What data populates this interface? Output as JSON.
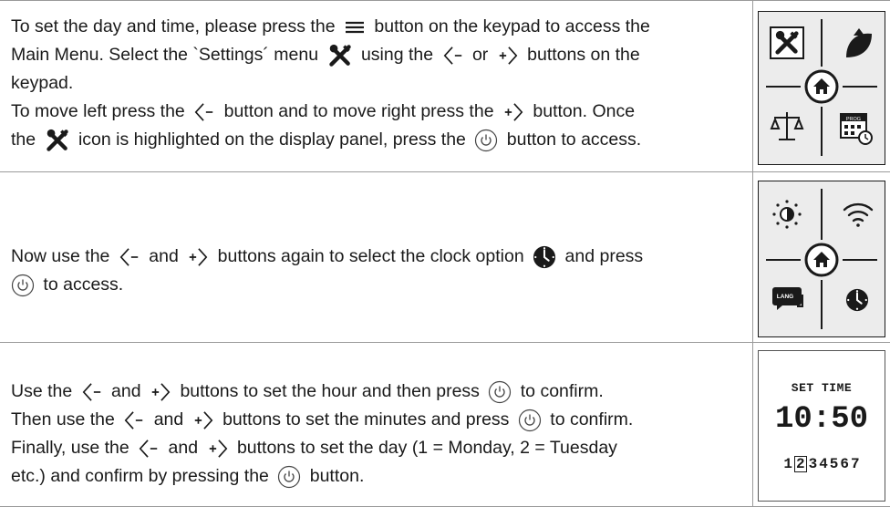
{
  "rows": [
    {
      "line1": {
        "a": "To set the day and time, please press the",
        "b": "button on the keypad to access the"
      },
      "line2": {
        "a": "Main Menu. Select the `Settings´ menu",
        "b": "using the",
        "c": "or",
        "d": "buttons on the"
      },
      "line3": {
        "a": "keypad."
      },
      "line4": {
        "a": "To move left press the",
        "b": "button and to move right press the",
        "c": "button. Once"
      },
      "line5": {
        "a": "the",
        "b": "icon is highlighted on the display panel, press the",
        "c": "button to access."
      }
    },
    {
      "line1": {
        "a": "Now use the",
        "b": "and",
        "c": "buttons again to select the clock option",
        "d": "and press"
      },
      "line2": {
        "a": "to access."
      },
      "lang_label": "LANG"
    },
    {
      "line1": {
        "a": "Use the",
        "b": "and",
        "c": "buttons to set the hour and then press",
        "d": "to confirm."
      },
      "line2": {
        "a": "Then use the",
        "b": "and",
        "c": "buttons to set the minutes and press",
        "d": "to confirm."
      },
      "line3": {
        "a": "Finally, use the",
        "b": "and",
        "c": "buttons to set the day (1 = Monday, 2 = Tuesday"
      },
      "line4": {
        "a": "etc.) and confirm by pressing the",
        "b": "button."
      }
    }
  ],
  "display": {
    "title": "SET TIME",
    "time": "10:50",
    "days": [
      "1",
      "2",
      "3",
      "4",
      "5",
      "6",
      "7"
    ],
    "selected_day": "2"
  },
  "panel1": {
    "prog_label": "PROG"
  }
}
